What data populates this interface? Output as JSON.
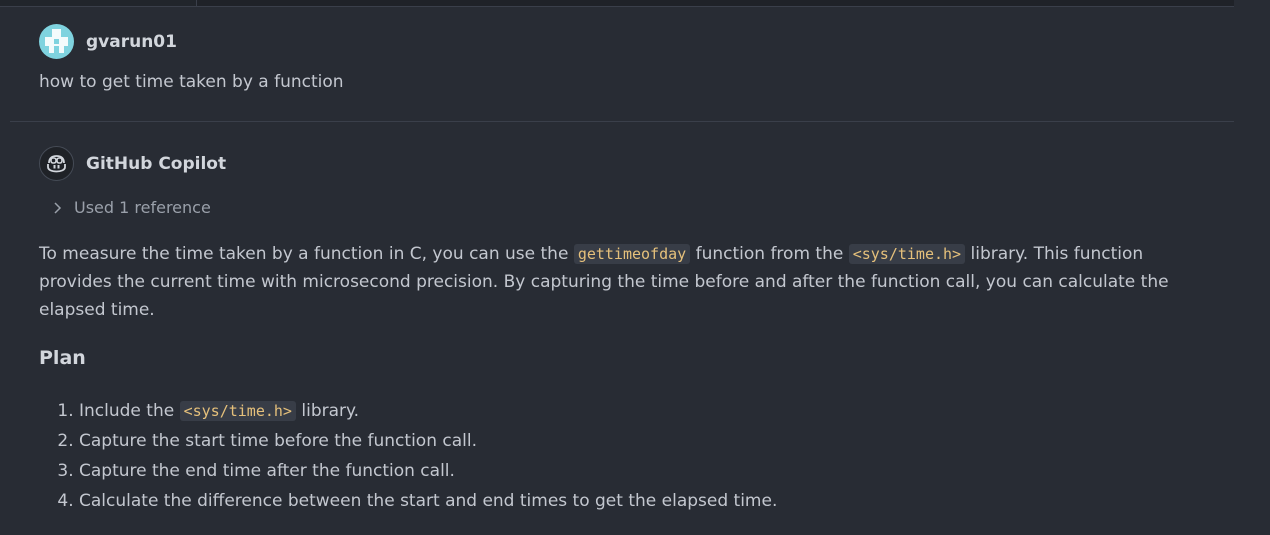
{
  "user_message": {
    "username": "gvarun01",
    "text": "how to get time taken by a function"
  },
  "bot_message": {
    "name": "GitHub Copilot",
    "reference_label": "Used 1 reference",
    "intro": {
      "t1": "To measure the time taken by a function in C, you can use the ",
      "code1": "gettimeofday",
      "t2": " function from the ",
      "code2": "<sys/time.h>",
      "t3": " library. This function provides the current time with microsecond precision. By capturing the time before and after the function call, you can calculate the elapsed time."
    },
    "plan_heading": "Plan",
    "plan": {
      "step1_prefix": "Include the ",
      "step1_code": "<sys/time.h>",
      "step1_suffix": " library.",
      "step2": "Capture the start time before the function call.",
      "step3": "Capture the end time after the function call.",
      "step4": "Calculate the difference between the start and end times to get the elapsed time."
    }
  },
  "colors": {
    "background": "#282c34",
    "code_text": "#e5c07b",
    "code_bg": "#383d47",
    "user_avatar": "#7fd3df"
  },
  "icons": {
    "user_avatar": "identicon-avatar",
    "bot_avatar": "copilot-icon",
    "reference_toggle": "chevron-right-icon"
  }
}
